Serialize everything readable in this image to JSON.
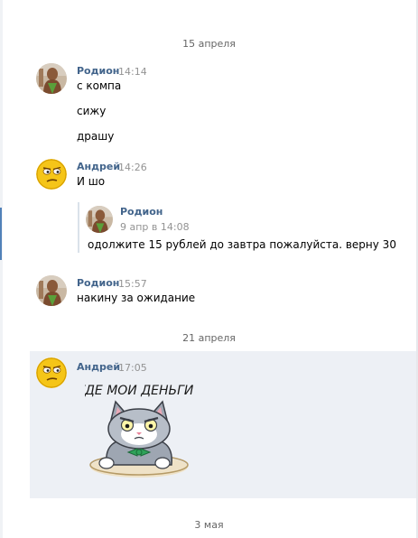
{
  "dates": {
    "first": "15 апреля",
    "second": "21 апреля",
    "third": "3 мая"
  },
  "messages": [
    {
      "author": "Родион",
      "time": "14:14",
      "lines": [
        "с компа",
        "сижу",
        "драшу"
      ]
    },
    {
      "author": "Андрей",
      "time": "14:26",
      "lines": [
        "И шо"
      ],
      "forwarded": {
        "author": "Родион",
        "date": "9 апр в 14:08",
        "text": "одолжите 15 рублей до завтра пожалуйста. верну 30"
      }
    },
    {
      "author": "Родион",
      "time": "15:57",
      "lines": [
        "накину за ожидание"
      ]
    },
    {
      "author": "Андрей",
      "time": "17:05",
      "sticker": {
        "caption": "ГДЕ МОИ ДЕНЬГИ?"
      }
    }
  ],
  "colors": {
    "author_link": "#42648b",
    "time": "#939393",
    "date_separator": "#656565",
    "selected_message_bg": "#edf0f5"
  },
  "icons": {
    "rodion_avatar": "photo-avatar",
    "andrey_avatar": "suspicious-emoji-avatar",
    "sticker": "cat-sticker"
  }
}
